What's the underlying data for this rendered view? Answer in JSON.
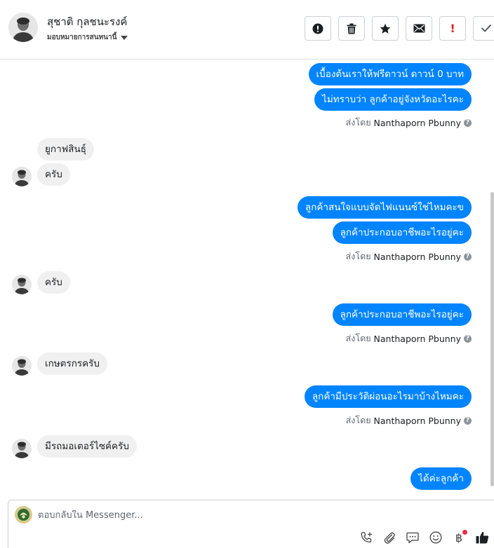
{
  "header": {
    "contact_name": "สุชาติ กุลชนะรงค์",
    "assign_label": "มอบหมายการสนทนานี้",
    "actions": [
      {
        "name": "mark-spam-button",
        "icon": "exclamation-circle-icon"
      },
      {
        "name": "delete-button",
        "icon": "trash-icon"
      },
      {
        "name": "star-button",
        "icon": "star-icon"
      },
      {
        "name": "mark-unread-button",
        "icon": "envelope-icon"
      },
      {
        "name": "follow-up-button",
        "icon": "exclamation-icon",
        "label": "!"
      },
      {
        "name": "mark-done-button",
        "icon": "check-icon"
      }
    ]
  },
  "messages": [
    {
      "dir": "out",
      "text": "เบื้องต้นเราให้ฟรีดาวน์ ดาวน์ 0 บาท"
    },
    {
      "dir": "out",
      "text": "ไม่ทราบว่า ลูกค้าอยู่จังหวัดอะไรคะ"
    },
    {
      "dir": "out",
      "text": "ลูกค้าสนใจแบบจัดไฟแนนซ์ใช่ไหมคะข"
    },
    {
      "dir": "out",
      "text": "ลูกค้าประกอบอาชีพอะไรอยู่คะ"
    },
    {
      "dir": "out",
      "text": "ลูกค้าประกอบอาชีพอะไรอยู่คะ"
    },
    {
      "dir": "out",
      "text": "ลูกค้ามีประวัติผ่อนอะไรมาบ้างไหมคะ"
    },
    {
      "dir": "out",
      "text": "ได้ค่ะลูกค้า"
    },
    {
      "dir": "in",
      "text": "ยูกาฟสินธุ์"
    },
    {
      "dir": "in",
      "text": "ครับ"
    },
    {
      "dir": "in",
      "text": "ครับ"
    },
    {
      "dir": "in",
      "text": "เกษตรกรครับ"
    },
    {
      "dir": "in",
      "text": "มีรถมอเตอร์ไซค์ครับ"
    }
  ],
  "sent_by": {
    "prefix": "ส่งโดย",
    "sender": "Nanthaporn Pbunny",
    "help_icon": "question-circle-icon"
  },
  "composer": {
    "placeholder": "ตอบกลับใน Messenger...",
    "tools": [
      "add-call-icon",
      "attachment-icon",
      "saved-reply-icon",
      "emoji-icon",
      "baht-payment-icon",
      "like-icon"
    ],
    "baht_symbol": "฿"
  },
  "colors": {
    "outgoing_bubble": "#0084ff",
    "incoming_bubble": "#f0f0f0",
    "notification_dot": "#f02849"
  }
}
